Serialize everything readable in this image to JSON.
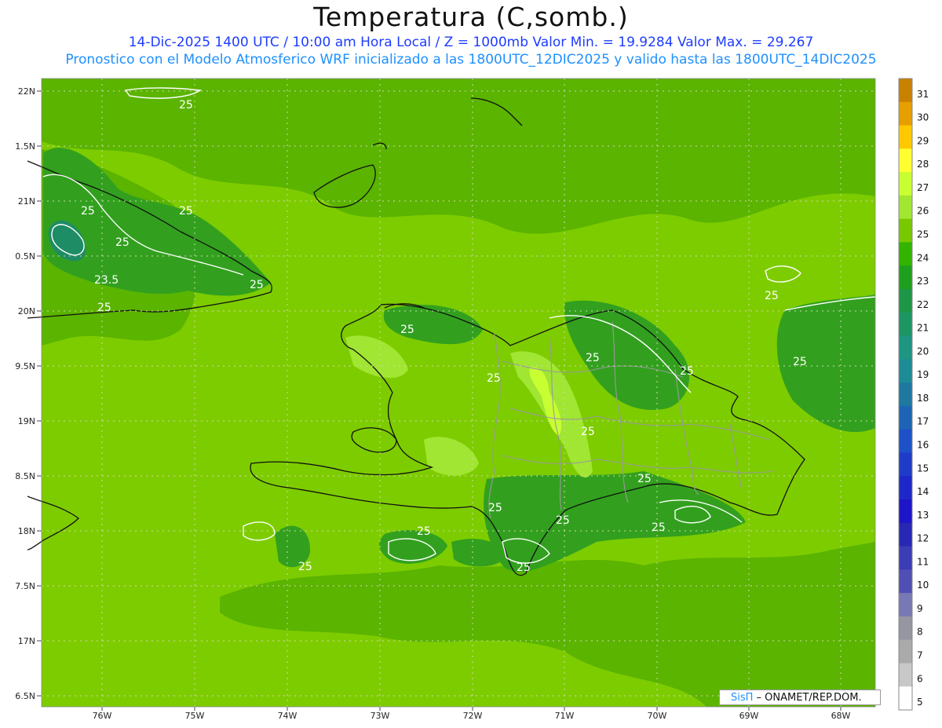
{
  "title": "Temperatura (C,somb.)",
  "subtitle1": "14-Dic-2025 1400 UTC / 10:00 am Hora Local / Z = 1000mb   Valor Min. = 19.9284  Valor Max. = 29.267",
  "subtitle2": "Pronostico con el Modelo Atmosferico WRF inicializado a las 1800UTC_12DIC2025 y valido hasta las  1800UTC_14DIC2025",
  "credit": {
    "brand": "SisΠ",
    "text": " – ONAMET/REP.DOM."
  },
  "lat_labels": [
    "22N",
    "1.5N",
    "21N",
    "0.5N",
    "20N",
    "9.5N",
    "19N",
    "8.5N",
    "18N",
    "7.5N",
    "17N",
    "6.5N"
  ],
  "lon_labels": [
    "76W",
    "75W",
    "74W",
    "73W",
    "72W",
    "71W",
    "70W",
    "69W",
    "68W"
  ],
  "colorbar": {
    "levels": [
      "31",
      "30",
      "29",
      "28",
      "27",
      "26",
      "25",
      "24",
      "23",
      "22",
      "21",
      "20",
      "19",
      "18",
      "17",
      "16",
      "15",
      "14",
      "13",
      "12",
      "11",
      "10",
      "9",
      "8",
      "7",
      "6",
      "5"
    ],
    "colors": [
      "#c88200",
      "#e69e00",
      "#ffc800",
      "#ffff32",
      "#c8ff32",
      "#a0e632",
      "#78c800",
      "#32b400",
      "#1ea01e",
      "#1e9646",
      "#1e9664",
      "#1e9682",
      "#1e8c96",
      "#1e78a0",
      "#1e64b4",
      "#1e50c8",
      "#1e3cc8",
      "#1e28c8",
      "#1e14c8",
      "#2828b4",
      "#3c3cb4",
      "#5050b4",
      "#7878b4",
      "#9696a0",
      "#aaaaaa",
      "#c8c8c8",
      "#ffffff"
    ]
  },
  "contour_labels": [
    "25",
    "25",
    "25",
    "25",
    "23.5",
    "25",
    "25",
    "25",
    "25",
    "25",
    "25",
    "25",
    "25",
    "25",
    "25",
    "25",
    "25",
    "25",
    "25",
    "25",
    "25"
  ],
  "field_colors": {
    "base": "#7dcc00",
    "mid": "#5ab400",
    "warm": "#a0e632",
    "cool": "#32a01e",
    "coolest": "#1e8c64",
    "border": "#999999",
    "coast": "#111111"
  }
}
